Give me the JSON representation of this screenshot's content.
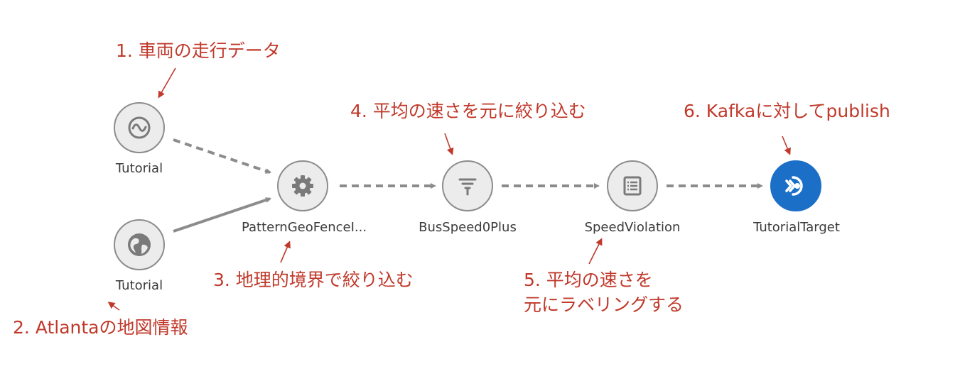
{
  "nodes": [
    {
      "id": "n1",
      "label": "Tutorial",
      "icon": "stream-icon",
      "interactable": true
    },
    {
      "id": "n2",
      "label": "Tutorial",
      "icon": "globe-icon",
      "interactable": true
    },
    {
      "id": "n3",
      "label": "PatternGeoFenceI...",
      "icon": "gear-icon",
      "interactable": true
    },
    {
      "id": "n4",
      "label": "BusSpeed0Plus",
      "icon": "funnel-icon",
      "interactable": true
    },
    {
      "id": "n5",
      "label": "SpeedViolation",
      "icon": "list-icon",
      "interactable": true
    },
    {
      "id": "n6",
      "label": "TutorialTarget",
      "icon": "kafka-target-icon",
      "interactable": true
    }
  ],
  "annotations": {
    "a1": "1. 車両の走行データ",
    "a2": "2. Atlantaの地図情報",
    "a3": "3. 地理的境界で絞り込む",
    "a4": "4. 平均の速さを元に絞り込む",
    "a5_line1": "5. 平均の速さを",
    "a5_line2": "元にラベリングする",
    "a6": "6. Kafkaに対してpublish"
  },
  "colors": {
    "annotation": "#c0392b",
    "edge": "#8c8c8c",
    "node_fill": "#ececec",
    "node_border": "#8c8c8c",
    "target_fill": "#1c6fc7"
  }
}
